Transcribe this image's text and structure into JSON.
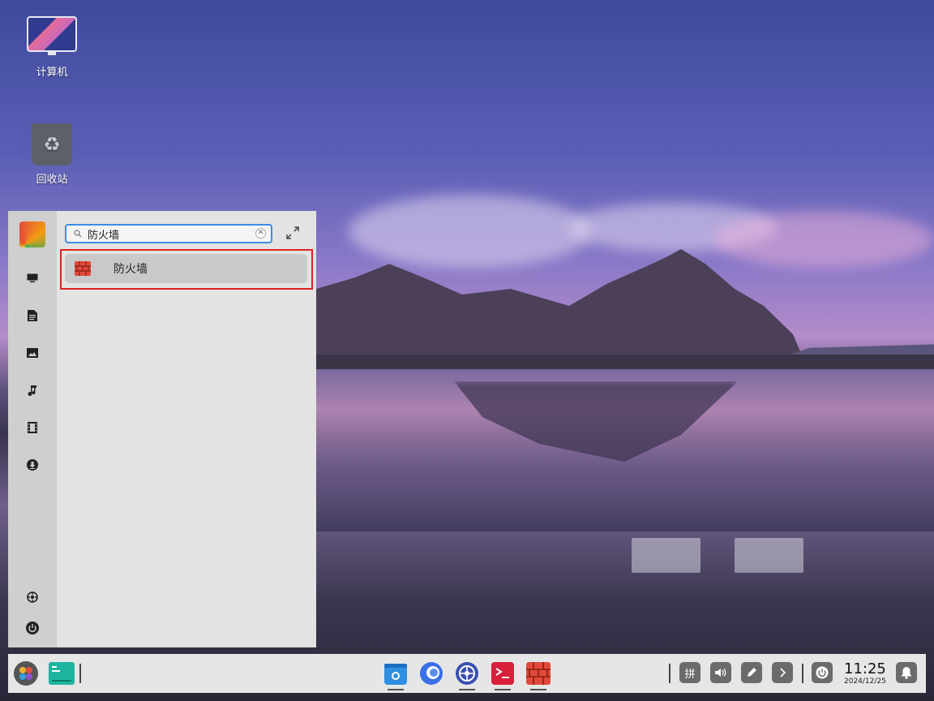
{
  "desktop": {
    "icons": [
      {
        "label": "计算机",
        "icon": "computer-icon"
      },
      {
        "label": "回收站",
        "icon": "trash-icon"
      }
    ]
  },
  "start_menu": {
    "search": {
      "value": "防火墙",
      "placeholder": ""
    },
    "sidebar_icons": [
      "computer-icon",
      "document-icon",
      "picture-icon",
      "music-icon",
      "video-icon",
      "download-icon",
      "settings-icon",
      "power-icon"
    ],
    "results": [
      {
        "label": "防火墙",
        "icon": "firewall-icon"
      }
    ]
  },
  "taskbar": {
    "apps": [
      "app-store-icon",
      "browser-icon",
      "settings-icon",
      "terminal-icon",
      "firewall-icon"
    ],
    "tray": {
      "input_method": "拼"
    },
    "clock": {
      "time": "11:25",
      "date": "2024/12/25"
    }
  },
  "colors": {
    "highlight_border": "#e02020",
    "search_border": "#3a8ee6",
    "firewall_red": "#e04a3a"
  }
}
